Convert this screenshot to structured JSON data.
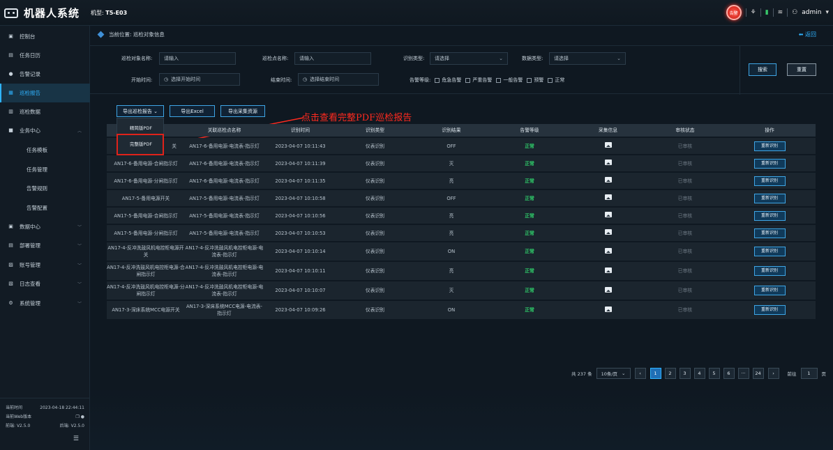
{
  "header": {
    "title": "机器人系统",
    "model_label": "机型:",
    "model_value": "T5-E03",
    "alarm_text": "告警",
    "user": "admin"
  },
  "sidebar": {
    "items": [
      {
        "label": "控制台",
        "icon": "monitor-icon"
      },
      {
        "label": "任务日历",
        "icon": "calendar-icon"
      },
      {
        "label": "告警记录",
        "icon": "alarm-icon"
      },
      {
        "label": "巡检报告",
        "icon": "report-icon",
        "active": true
      },
      {
        "label": "巡检数据",
        "icon": "data-icon"
      },
      {
        "label": "业务中心",
        "icon": "folder-icon",
        "expanded": true,
        "children": [
          {
            "label": "任务模板"
          },
          {
            "label": "任务管理"
          },
          {
            "label": "告警规则"
          },
          {
            "label": "告警配置"
          }
        ]
      },
      {
        "label": "数据中心",
        "icon": "database-icon"
      },
      {
        "label": "部署管理",
        "icon": "deploy-icon"
      },
      {
        "label": "账号管理",
        "icon": "account-icon"
      },
      {
        "label": "日志查看",
        "icon": "log-icon"
      },
      {
        "label": "系统管理",
        "icon": "settings-icon"
      }
    ],
    "footer": {
      "time_label": "当前时间",
      "time_value": "2023-04-18 22:44:11",
      "version_label": "当前Web版本",
      "front_label": "前端:",
      "front_version": "V2.5.0",
      "back_label": "后端:",
      "back_version": "V2.5.0"
    }
  },
  "breadcrumb": {
    "text": "当前位置: 巡检对象信息",
    "back": "返回"
  },
  "filters": {
    "obj_name_label": "巡检对象名称:",
    "obj_name_placeholder": "请输入",
    "point_name_label": "巡检点名称:",
    "point_name_placeholder": "请输入",
    "recog_type_label": "识别类型:",
    "recog_type_placeholder": "请选择",
    "data_type_label": "数据类型:",
    "data_type_placeholder": "请选择",
    "start_label": "开始时间:",
    "start_placeholder": "选择开始时间",
    "end_label": "结束时间:",
    "end_placeholder": "选择结束时间",
    "level_label": "告警等级:",
    "levels": [
      "危急告警",
      "严重告警",
      "一般告警",
      "预警",
      "正常"
    ],
    "search": "搜索",
    "reset": "重置"
  },
  "actions": {
    "export_report": "导出巡检报告",
    "export_excel": "导出Excel",
    "export_resource": "导出采集资源",
    "menu": [
      "精简版PDF",
      "完整版PDF"
    ]
  },
  "annotation": "点击查看完整PDF巡检报告",
  "table": {
    "headers": [
      "",
      "关联巡检点名称",
      "识别时间",
      "识别类型",
      "识别结果",
      "告警等级",
      "采集信息",
      "审核状态",
      "操作"
    ],
    "rows": [
      {
        "obj": "关",
        "point": "AN17-6-备用电源-电流表-指示灯",
        "time": "2023-04-07 10:11:43",
        "type": "仪表识别",
        "result": "OFF",
        "level": "正常",
        "status": "已审核",
        "op": "重新识别"
      },
      {
        "obj": "AN17-6-备用电源-合闸指示灯",
        "point": "AN17-6-备用电源-电流表-指示灯",
        "time": "2023-04-07 10:11:39",
        "type": "仪表识别",
        "result": "灭",
        "level": "正常",
        "status": "已审核",
        "op": "重新识别"
      },
      {
        "obj": "AN17-6-备用电源-分闸指示灯",
        "point": "AN17-6-备用电源-电流表-指示灯",
        "time": "2023-04-07 10:11:35",
        "type": "仪表识别",
        "result": "亮",
        "level": "正常",
        "status": "已审核",
        "op": "重新识别"
      },
      {
        "obj": "AN17-5-备用电源开关",
        "point": "AN17-5-备用电源-电流表-指示灯",
        "time": "2023-04-07 10:10:58",
        "type": "仪表识别",
        "result": "OFF",
        "level": "正常",
        "status": "已审核",
        "op": "重新识别"
      },
      {
        "obj": "AN17-5-备用电源-合闸指示灯",
        "point": "AN17-5-备用电源-电流表-指示灯",
        "time": "2023-04-07 10:10:56",
        "type": "仪表识别",
        "result": "亮",
        "level": "正常",
        "status": "已审核",
        "op": "重新识别"
      },
      {
        "obj": "AN17-5-备用电源-分闸指示灯",
        "point": "AN17-5-备用电源-电流表-指示灯",
        "time": "2023-04-07 10:10:53",
        "type": "仪表识别",
        "result": "亮",
        "level": "正常",
        "status": "已审核",
        "op": "重新识别"
      },
      {
        "obj": "AN17-4-反冲洗鼓风机电控柜电源开关",
        "point": "AN17-4-反冲洗鼓风机电控柜电源-电流表-指示灯",
        "time": "2023-04-07 10:10:14",
        "type": "仪表识别",
        "result": "ON",
        "level": "正常",
        "status": "已审核",
        "op": "重新识别"
      },
      {
        "obj": "AN17-4-反冲洗鼓风机电控柜电源-合闸指示灯",
        "point": "AN17-4-反冲洗鼓风机电控柜电源-电流表-指示灯",
        "time": "2023-04-07 10:10:11",
        "type": "仪表识别",
        "result": "亮",
        "level": "正常",
        "status": "已审核",
        "op": "重新识别"
      },
      {
        "obj": "AN17-4-反冲洗鼓风机电控柜电源-分闸指示灯",
        "point": "AN17-4-反冲洗鼓风机电控柜电源-电流表-指示灯",
        "time": "2023-04-07 10:10:07",
        "type": "仪表识别",
        "result": "灭",
        "level": "正常",
        "status": "已审核",
        "op": "重新识别"
      },
      {
        "obj": "AN17-3-深床系统MCC电源开关",
        "point": "AN17-3-深床系统MCC电源-电流表-指示灯",
        "time": "2023-04-07 10:09:26",
        "type": "仪表识别",
        "result": "ON",
        "level": "正常",
        "status": "已审核",
        "op": "重新识别"
      }
    ]
  },
  "pagination": {
    "total": "共 237 条",
    "page_size": "10条/页",
    "pages": [
      "1",
      "2",
      "3",
      "4",
      "5",
      "6",
      "···",
      "24"
    ],
    "current": "1",
    "goto_label": "前往",
    "goto_value": "1",
    "page_unit": "页"
  },
  "colors": {
    "accent": "#2fb3ff",
    "ok": "#2fd06b",
    "annotation": "#ff2a1f"
  }
}
